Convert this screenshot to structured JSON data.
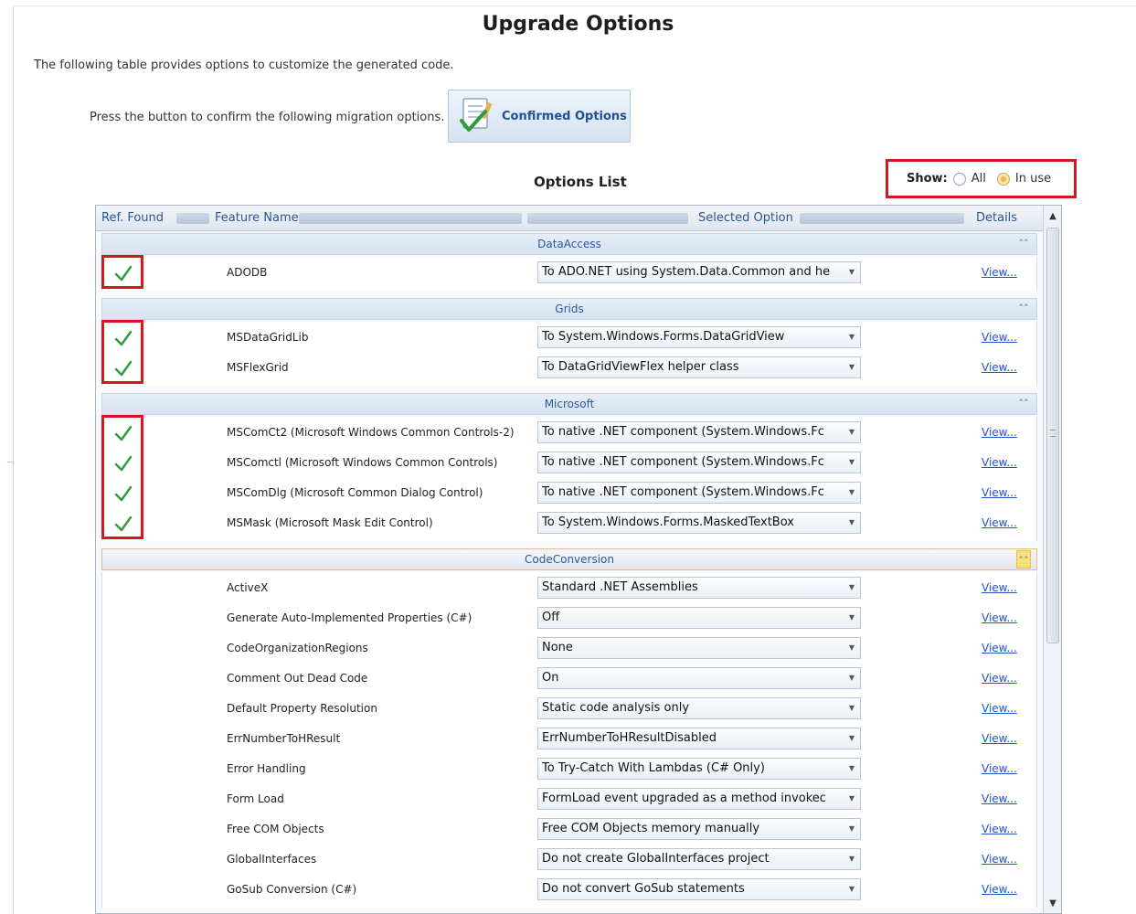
{
  "page": {
    "title": "Upgrade Options",
    "intro": "The following table provides options to customize the generated code.",
    "confirm_label": "Press the button to confirm the following migration options.",
    "confirm_button": "Confirmed Options"
  },
  "options_list": {
    "title": "Options List",
    "show_label": "Show:",
    "filter_all": "All",
    "filter_in_use": "In use",
    "filter_selected": "In use"
  },
  "grid": {
    "columns": [
      "Ref. Found",
      "Feature Name",
      "Selected Option",
      "Details"
    ],
    "view_label": "View...",
    "colors": {
      "check": "#2e9a3a",
      "highlight": "#d4171f",
      "link": "#1f57c5"
    },
    "groups": [
      {
        "name": "DataAccess",
        "rows": [
          {
            "ref_found": true,
            "feature": "ADODB",
            "option": "To ADO.NET using System.Data.Common and he"
          }
        ]
      },
      {
        "name": "Grids",
        "rows": [
          {
            "ref_found": true,
            "feature": "MSDataGridLib",
            "option": "To System.Windows.Forms.DataGridView"
          },
          {
            "ref_found": true,
            "feature": "MSFlexGrid",
            "option": "To DataGridViewFlex helper class"
          }
        ]
      },
      {
        "name": "Microsoft",
        "rows": [
          {
            "ref_found": true,
            "feature": "MSComCt2 (Microsoft Windows Common Controls-2)",
            "option": "To native .NET component (System.Windows.Fc"
          },
          {
            "ref_found": true,
            "feature": "MSComctl (Microsoft Windows Common Controls)",
            "option": "To native .NET component (System.Windows.Fc"
          },
          {
            "ref_found": true,
            "feature": "MSComDlg (Microsoft Common Dialog Control)",
            "option": "To native .NET component (System.Windows.Fc"
          },
          {
            "ref_found": true,
            "feature": "MSMask (Microsoft Mask Edit Control)",
            "option": "To System.Windows.Forms.MaskedTextBox"
          }
        ]
      },
      {
        "name": "CodeConversion",
        "rows": [
          {
            "ref_found": false,
            "feature": "ActiveX",
            "option": "Standard .NET Assemblies"
          },
          {
            "ref_found": false,
            "feature": "Generate Auto-Implemented Properties (C#)",
            "option": "Off"
          },
          {
            "ref_found": false,
            "feature": "CodeOrganizationRegions",
            "option": "None"
          },
          {
            "ref_found": false,
            "feature": "Comment Out Dead Code",
            "option": "On"
          },
          {
            "ref_found": false,
            "feature": "Default Property Resolution",
            "option": "Static code analysis only"
          },
          {
            "ref_found": false,
            "feature": "ErrNumberToHResult",
            "option": "ErrNumberToHResultDisabled"
          },
          {
            "ref_found": false,
            "feature": "Error Handling",
            "option": "To Try-Catch With Lambdas (C# Only)"
          },
          {
            "ref_found": false,
            "feature": "Form Load",
            "option": "FormLoad event upgraded as a method invokec"
          },
          {
            "ref_found": false,
            "feature": "Free COM Objects",
            "option": "Free COM Objects memory manually"
          },
          {
            "ref_found": false,
            "feature": "GlobalInterfaces",
            "option": "Do not create GlobalInterfaces project"
          },
          {
            "ref_found": false,
            "feature": "GoSub Conversion (C#)",
            "option": "Do not convert GoSub statements"
          }
        ]
      }
    ]
  }
}
